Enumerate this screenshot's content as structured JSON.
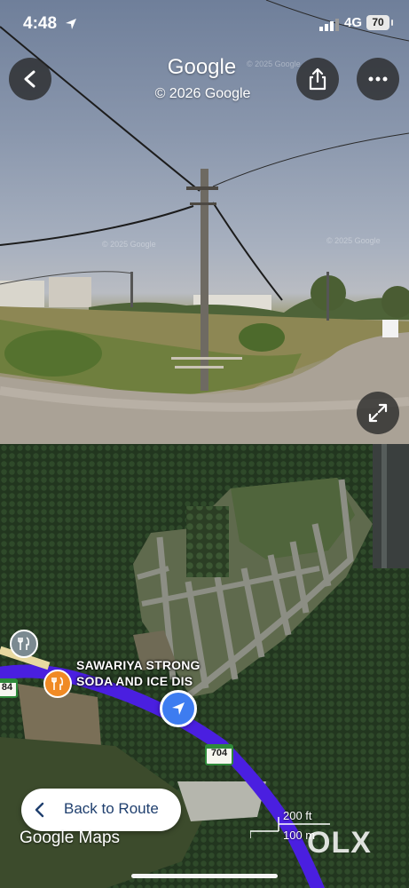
{
  "status_bar": {
    "time": "4:48",
    "network": "4G",
    "battery": "70"
  },
  "street_view": {
    "title": "Google",
    "copyright": "© 2026 Google",
    "watermarks": [
      "© 2025 Google",
      "© 2025 Google",
      "© 2025 Google"
    ],
    "icons": {
      "back": "chevron-left-icon",
      "share": "share-icon",
      "more": "more-horizontal-icon",
      "expand": "expand-icon"
    }
  },
  "map": {
    "poi_label": "SAWARIYA STRONG SODA AND ICE DIS",
    "route_shields": [
      "704",
      "84"
    ],
    "back_to_route_label": "Back to Route",
    "logo": "Google Maps",
    "scale": {
      "imperial": "200 ft",
      "metric": "100 m"
    },
    "route_color": "#4a1fe0",
    "location_color": "#3d7cf0"
  },
  "watermark": "OLX"
}
